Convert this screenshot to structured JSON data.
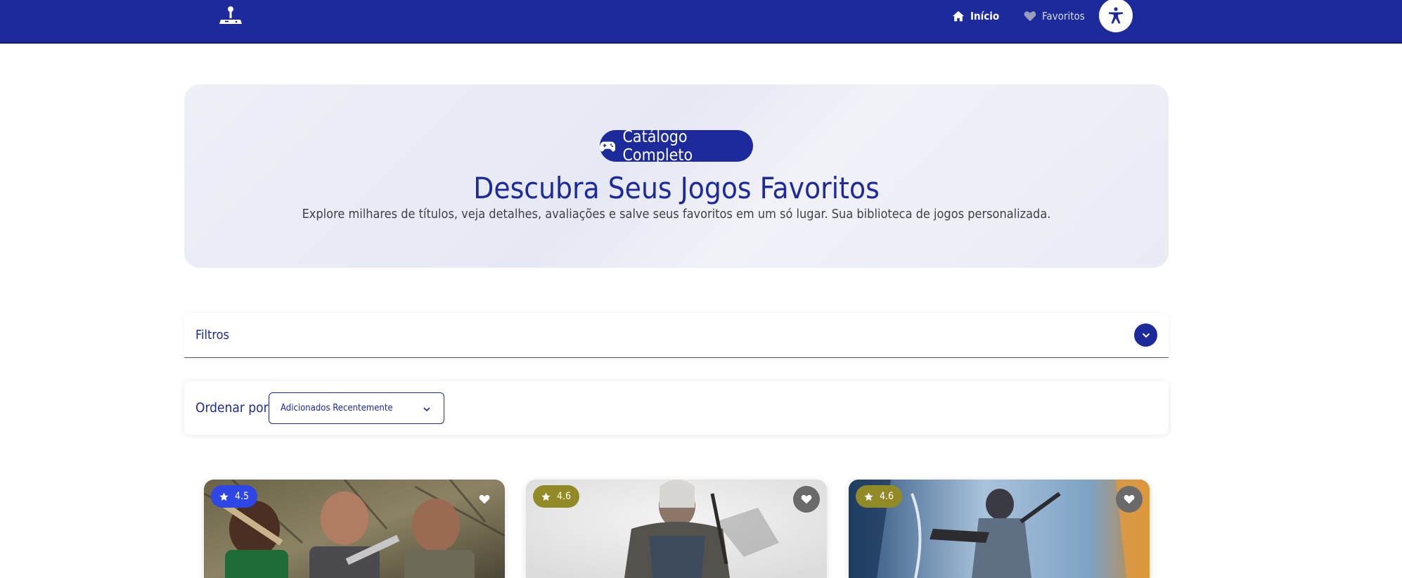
{
  "nav": {
    "logo_icon": "joystick-icon",
    "home_label": "Início",
    "home_icon": "home-icon",
    "favorites_label": "Favoritos",
    "favorites_icon": "heart-icon",
    "accessibility_icon": "accessibility-icon"
  },
  "hero": {
    "badge_icon": "gamepad-icon",
    "badge_label": "Catálogo Completo",
    "title": "Descubra Seus Jogos Favoritos",
    "subtitle": "Explore milhares de títulos, veja detalhes, avaliações e salve seus favoritos em um só lugar. Sua biblioteca de jogos personalizada."
  },
  "filters": {
    "label": "Filtros",
    "toggle_icon": "chevron-down-icon"
  },
  "sort": {
    "label": "Ordenar por:",
    "selected": "Adicionados Recentemente",
    "icon": "chevron-down-icon"
  },
  "games": [
    {
      "rating": "4.5",
      "rating_icon": "star-icon",
      "favorite_icon": "heart-icon",
      "accent": "#2e46e6"
    },
    {
      "rating": "4.6",
      "rating_icon": "star-icon",
      "favorite_icon": "heart-icon",
      "accent": "#918a27"
    },
    {
      "rating": "4.6",
      "rating_icon": "star-icon",
      "favorite_icon": "heart-icon",
      "accent": "#918a27"
    }
  ],
  "colors": {
    "brand": "#1d2a9c",
    "hero_background": "#eceef7",
    "text_muted": "#3f3f4a"
  }
}
